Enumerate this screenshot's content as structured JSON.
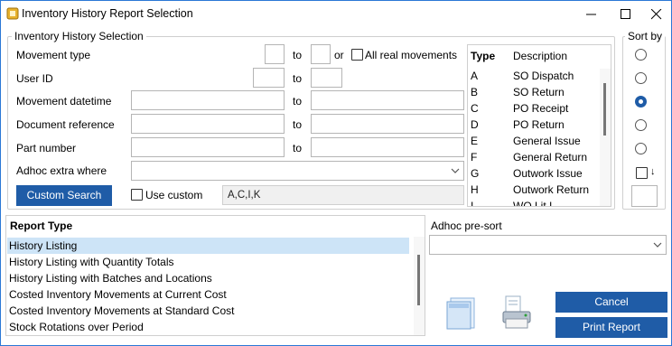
{
  "window": {
    "title": "Inventory History Report Selection"
  },
  "selection": {
    "group_title": "Inventory History Selection",
    "movement_type_label": "Movement type",
    "user_id_label": "User ID",
    "movement_datetime_label": "Movement datetime",
    "document_reference_label": "Document reference",
    "part_number_label": "Part number",
    "adhoc_label": "Adhoc extra where",
    "to_label": "to",
    "or_label": "or",
    "all_real_label": "All real movements",
    "custom_search_label": "Custom Search",
    "use_custom_label": "Use custom",
    "custom_value": "A,C,I,K"
  },
  "type_list": {
    "col_type": "Type",
    "col_desc": "Description",
    "rows": [
      {
        "type": "A",
        "desc": "SO Dispatch"
      },
      {
        "type": "B",
        "desc": "SO Return"
      },
      {
        "type": "C",
        "desc": "PO Receipt"
      },
      {
        "type": "D",
        "desc": "PO Return"
      },
      {
        "type": "E",
        "desc": "General Issue"
      },
      {
        "type": "F",
        "desc": "General Return"
      },
      {
        "type": "G",
        "desc": "Outwork Issue"
      },
      {
        "type": "H",
        "desc": "Outwork Return"
      },
      {
        "type": "I",
        "desc": "WO Lit I"
      }
    ]
  },
  "sort": {
    "title": "Sort by",
    "selected_index": 2,
    "desc_arrow": "↓"
  },
  "report_type": {
    "header": "Report Type",
    "items": [
      "History Listing",
      "History Listing with Quantity Totals",
      "History Listing with Batches and Locations",
      "Costed Inventory Movements at Current Cost",
      "Costed Inventory Movements at Standard Cost",
      "Stock Rotations over Period"
    ],
    "selected_index": 0
  },
  "adhoc_presort": {
    "label": "Adhoc pre-sort"
  },
  "actions": {
    "cancel_label": "Cancel",
    "print_label": "Print Report"
  },
  "colors": {
    "accent": "#1f5ca7",
    "border": "#2b78d6",
    "selection": "#cde4f7"
  }
}
